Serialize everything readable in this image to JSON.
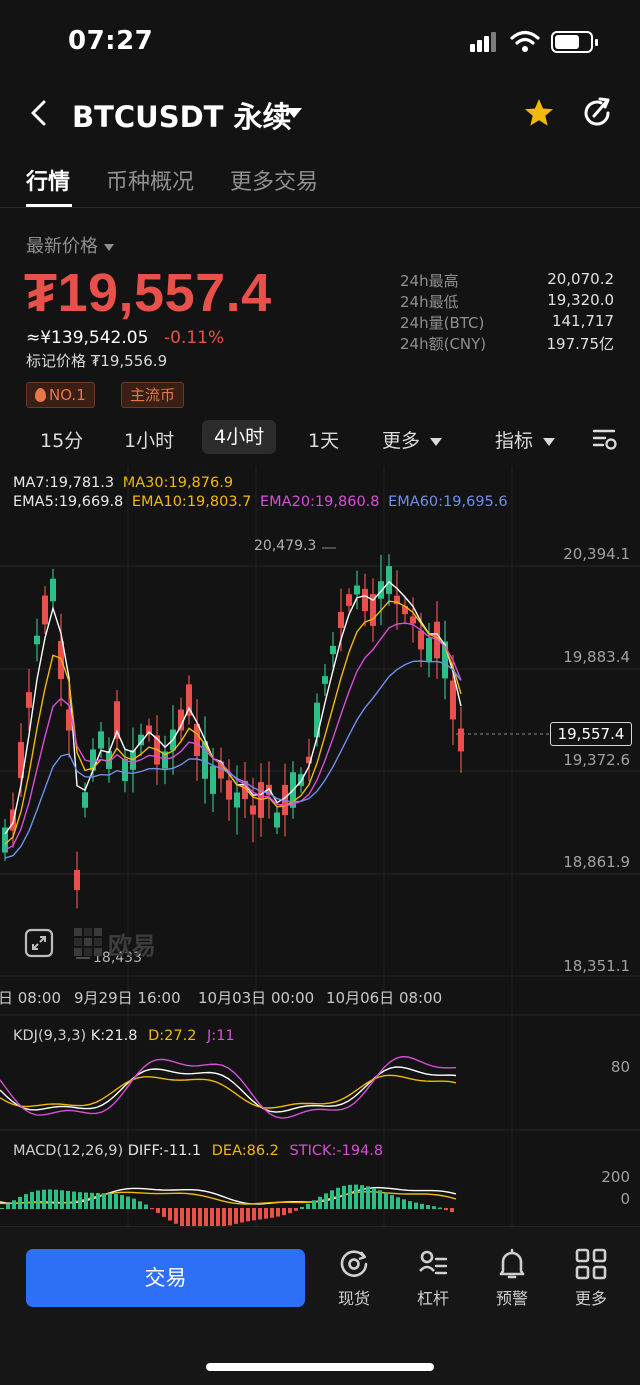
{
  "status": {
    "time": "07:27"
  },
  "header": {
    "pair": "BTCUSDT 永续"
  },
  "tabs": [
    "行情",
    "币种概况",
    "更多交易"
  ],
  "price": {
    "label": "最新价格",
    "last": "₮19,557.4",
    "cny": "≈¥139,542.05",
    "change": "-0.11%",
    "mark": "标记价格 ₮19,556.9",
    "badges": [
      "NO.1",
      "主流币"
    ]
  },
  "stats": [
    {
      "k": "24h最高",
      "v": "20,070.2"
    },
    {
      "k": "24h最低",
      "v": "19,320.0"
    },
    {
      "k": "24h量(BTC)",
      "v": "141,717"
    },
    {
      "k": "24h额(CNY)",
      "v": "197.75亿"
    }
  ],
  "intervals": {
    "i1": "15分",
    "i2": "1小时",
    "i3": "4小时",
    "i4": "1天",
    "more": "更多",
    "indicators": "指标"
  },
  "ma": {
    "ma7": "MA7:19,781.3",
    "ma30": "MA30:19,876.9",
    "ema5": "EMA5:19,669.8",
    "ema10": "EMA10:19,803.7",
    "ema20": "EMA20:19,860.8",
    "ema60": "EMA60:19,695.6"
  },
  "kdj": {
    "title": "KDJ(9,3,3)",
    "k": "K:21.8",
    "d": "D:27.2",
    "j": "J:11",
    "axis": "80"
  },
  "macd": {
    "title": "MACD(12,26,9)",
    "diff": "DIFF:-11.1",
    "dea": "DEA:86.2",
    "stick": "STICK:-194.8",
    "axis_top": "200",
    "axis_zero": "0"
  },
  "chart_data": {
    "type": "candlestick",
    "y_ticks": [
      "20,394.1",
      "19,883.4",
      "19,372.6",
      "18,861.9",
      "18,351.1"
    ],
    "x_ticks": [
      "日 08:00",
      "9月29日 16:00",
      "10月03日 00:00",
      "10月06日 08:00"
    ],
    "high_label": "20,479.3",
    "low_label": "18,433",
    "current_price": "19,557.4",
    "watermark": "欧易",
    "colors": {
      "up": "#2ebd85",
      "down": "#e8504a",
      "ma7": "#ffffff",
      "ma30": "#f0b90b",
      "ema20": "#d64fd6",
      "ema60": "#6f8fe8"
    }
  },
  "bottom": {
    "trade": "交易",
    "nav": [
      "现货",
      "杠杆",
      "预警",
      "更多"
    ]
  }
}
